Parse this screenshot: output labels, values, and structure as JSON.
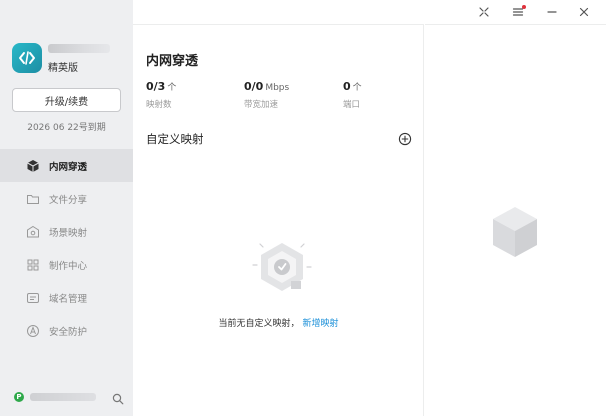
{
  "sidebar": {
    "plan_label": "精英版",
    "upgrade_label": "升级/续费",
    "expire_date": "2026 06 22号到期",
    "nav_items": [
      {
        "label": "内网穿透",
        "icon": "cube-icon",
        "active": true
      },
      {
        "label": "文件分享",
        "icon": "folder-icon",
        "active": false
      },
      {
        "label": "场景映射",
        "icon": "scene-icon",
        "active": false
      },
      {
        "label": "制作中心",
        "icon": "grid-icon",
        "active": false
      },
      {
        "label": "域名管理",
        "icon": "domain-icon",
        "active": false
      },
      {
        "label": "安全防护",
        "icon": "shield-icon",
        "active": false
      }
    ]
  },
  "main": {
    "title": "内网穿透",
    "stats": [
      {
        "value": "0/3",
        "unit": "个",
        "label": "映射数"
      },
      {
        "value": "0/0",
        "unit": "Mbps",
        "label": "带宽加速"
      },
      {
        "value": "0",
        "unit": "个",
        "label": "端口"
      }
    ],
    "section_title": "自定义映射",
    "empty_text": "当前无自定义映射，",
    "empty_link": "新增映射"
  },
  "colors": {
    "accent_link": "#1a8fd8",
    "logo": "#28b8c8",
    "sidebar_bg": "#eeeff1",
    "status_green": "#2ea84a"
  }
}
